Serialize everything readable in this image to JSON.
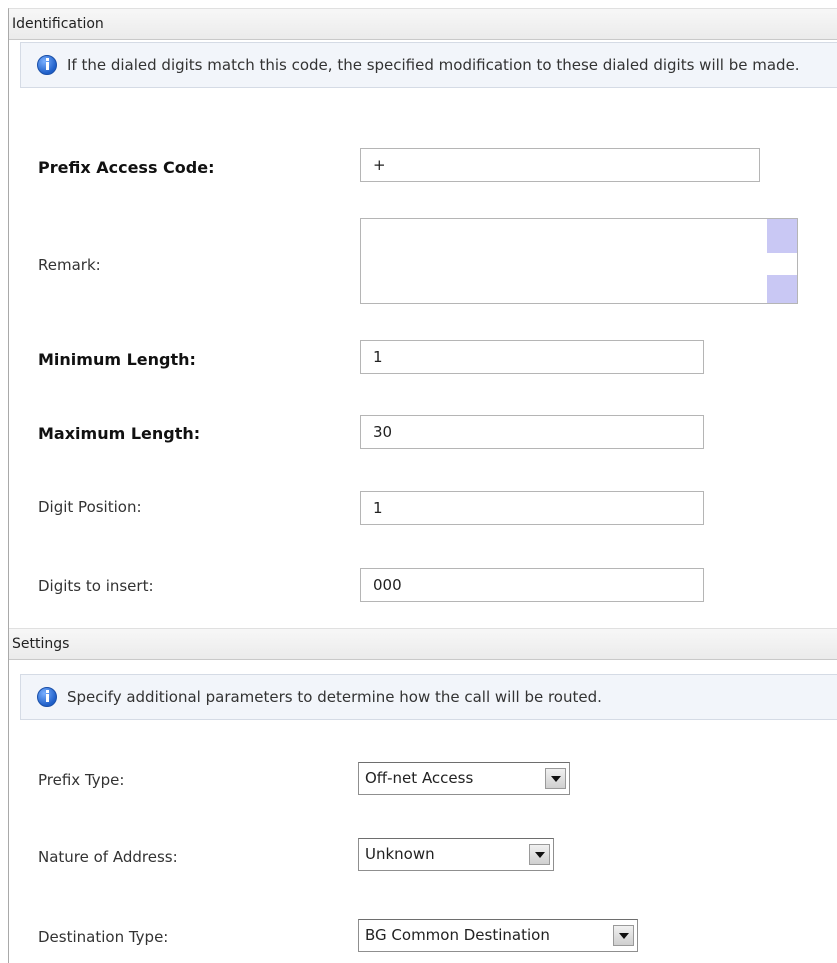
{
  "identification": {
    "header": "Identification",
    "info": "If the dialed digits match this code, the specified modification to these dialed digits will be made.",
    "fields": {
      "prefix_access_code": {
        "label": "Prefix Access Code:",
        "value": "+"
      },
      "remark": {
        "label": "Remark:",
        "value": ""
      },
      "minimum_length": {
        "label": "Minimum Length:",
        "value": "1"
      },
      "maximum_length": {
        "label": "Maximum Length:",
        "value": "30"
      },
      "digit_position": {
        "label": "Digit Position:",
        "value": "1"
      },
      "digits_to_insert": {
        "label": "Digits to insert:",
        "value": "000"
      }
    }
  },
  "settings": {
    "header": "Settings",
    "info": "Specify additional parameters to determine how the call will be routed.",
    "fields": {
      "prefix_type": {
        "label": "Prefix Type:",
        "value": "Off-net Access"
      },
      "nature_of_address": {
        "label": "Nature of Address:",
        "value": "Unknown"
      },
      "destination_type": {
        "label": "Destination Type:",
        "value": "BG Common Destination"
      }
    }
  },
  "icons": {
    "info": "info-icon",
    "dropdown": "chevron-down-icon"
  },
  "colors": {
    "scrollbar": "#c9c8f4",
    "info_bar_bg": "#f2f5fa",
    "header_bg": "#ebebeb"
  }
}
